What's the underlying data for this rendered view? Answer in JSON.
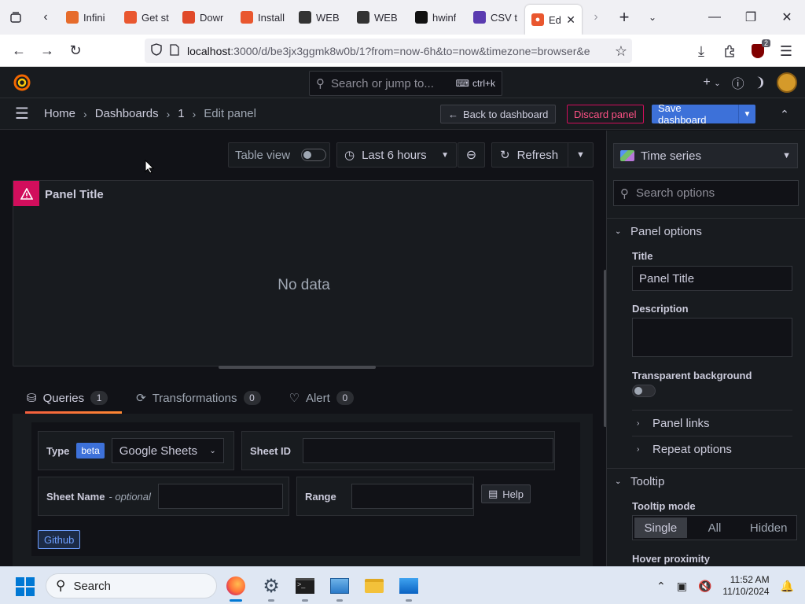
{
  "browser": {
    "tabs": [
      {
        "label": "Infini",
        "fav_color": "#e66b2b"
      },
      {
        "label": "Get st",
        "fav_color": "#e9572f"
      },
      {
        "label": "Dowr",
        "fav_color": "#e04a2a"
      },
      {
        "label": "Install",
        "fav_color": "#e9572f"
      },
      {
        "label": "WEB",
        "fav_color": "#333333"
      },
      {
        "label": "WEB",
        "fav_color": "#333333"
      },
      {
        "label": "hwinf",
        "fav_color": "#111111"
      },
      {
        "label": "CSV t",
        "fav_color": "#5a3bb0"
      }
    ],
    "active_tab": {
      "label": "Edi",
      "fav_color": "#e9572f"
    },
    "url_host": "localhost",
    "url_path": ":3000/d/be3jx3ggmk8w0b/1?from=now-6h&to=now&timezone=browser&e",
    "extension_badge": "2"
  },
  "grafana": {
    "search_placeholder": "Search or jump to...",
    "search_shortcut": "ctrl+k",
    "breadcrumbs": [
      "Home",
      "Dashboards",
      "1",
      "Edit panel"
    ],
    "back_label": "Back to dashboard",
    "discard_label": "Discard panel",
    "save_label": "Save dashboard"
  },
  "toolbar": {
    "table_view_label": "Table view",
    "time_range_label": "Last 6 hours",
    "refresh_label": "Refresh"
  },
  "panel": {
    "title": "Panel Title",
    "no_data": "No data"
  },
  "query_tabs": [
    {
      "label": "Queries",
      "count": "1"
    },
    {
      "label": "Transformations",
      "count": "0"
    },
    {
      "label": "Alert",
      "count": "0"
    }
  ],
  "query": {
    "type_label": "Type",
    "beta_badge": "beta",
    "type_value": "Google Sheets",
    "sheet_id_label": "Sheet ID",
    "sheet_name_label": "Sheet Name",
    "optional_label": "- optional",
    "range_label": "Range",
    "help_label": "Help",
    "github_label": "Github"
  },
  "options": {
    "viz_label": "Time series",
    "search_placeholder": "Search options",
    "panel_options_header": "Panel options",
    "title_label": "Title",
    "title_value": "Panel Title",
    "description_label": "Description",
    "transparent_label": "Transparent background",
    "panel_links": "Panel links",
    "repeat_options": "Repeat options",
    "tooltip_header": "Tooltip",
    "tooltip_mode_label": "Tooltip mode",
    "tooltip_modes": [
      "Single",
      "All",
      "Hidden"
    ],
    "tooltip_selected": "Single",
    "hover_proximity_label": "Hover proximity"
  },
  "taskbar": {
    "search_label": "Search",
    "time": "11:52 AM",
    "date": "11/10/2024"
  }
}
